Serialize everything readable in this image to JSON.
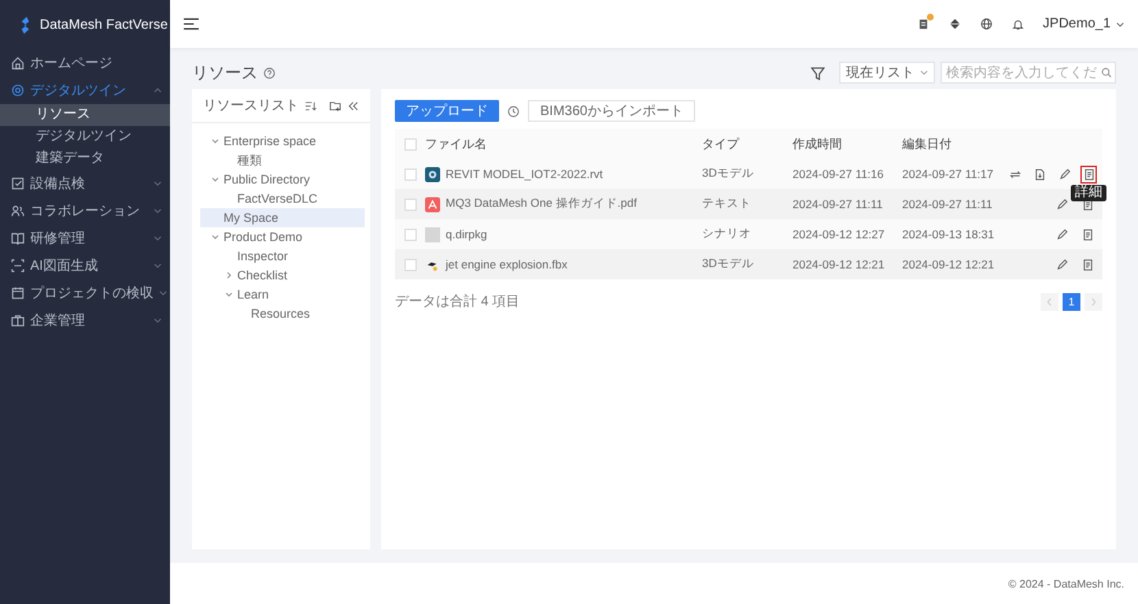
{
  "brand": {
    "name": "DataMesh FactVerse"
  },
  "sidebar": {
    "items": [
      {
        "label": "ホームページ",
        "selected": false
      },
      {
        "label": "デジタルツイン",
        "expanded": true,
        "selected": true,
        "children": [
          {
            "label": "リソース",
            "selected": true
          },
          {
            "label": "デジタルツイン",
            "selected": false
          },
          {
            "label": "建築データ",
            "selected": false
          }
        ]
      },
      {
        "label": "設備点検",
        "expanded": false,
        "selected": false
      },
      {
        "label": "コラボレーション",
        "expanded": false,
        "selected": false
      },
      {
        "label": "研修管理",
        "expanded": false,
        "selected": false
      },
      {
        "label": "AI図面生成",
        "expanded": false,
        "selected": false
      },
      {
        "label": "プロジェクトの検収",
        "expanded": false,
        "selected": false
      },
      {
        "label": "企業管理",
        "expanded": false,
        "selected": false
      }
    ]
  },
  "header": {
    "notification_badge": true,
    "user": "JPDemo_1"
  },
  "page": {
    "title": "リソース"
  },
  "filter": {
    "scope": "現在リスト",
    "placeholder": "検索内容を入力してくだ"
  },
  "tree_panel": {
    "title": "リソースリスト",
    "nodes": [
      {
        "label": "Enterprise space",
        "expanded": true,
        "selected": false,
        "children": [
          {
            "label": "種類",
            "selected": false
          }
        ]
      },
      {
        "label": "Public Directory",
        "expanded": true,
        "selected": false,
        "children": [
          {
            "label": "FactVerseDLC",
            "selected": false
          }
        ]
      },
      {
        "label": "My Space",
        "selected": true
      },
      {
        "label": "Product Demo",
        "expanded": true,
        "selected": false,
        "children": [
          {
            "label": "Inspector",
            "selected": false
          },
          {
            "label": "Checklist",
            "expanded": false,
            "selected": false
          },
          {
            "label": "Learn",
            "expanded": true,
            "selected": false,
            "children": [
              {
                "label": "Resources",
                "selected": false
              }
            ]
          }
        ]
      }
    ]
  },
  "toolbar": {
    "upload": "アップロード",
    "import": "BIM360からインポート"
  },
  "table": {
    "all_checked": false,
    "columns": [
      "ファイル名",
      "タイプ",
      "作成時間",
      "編集日付"
    ],
    "rows": [
      {
        "kind": "model",
        "checked": false,
        "name": "REVIT MODEL_IOT2-2022.rvt",
        "type": "3Dモデル",
        "created": "2024-09-27 11:16",
        "edited": "2024-09-27 11:17",
        "actions": [
          {
            "kind": "sync",
            "highlighted": false
          },
          {
            "kind": "download",
            "highlighted": false
          },
          {
            "kind": "edit",
            "highlighted": false
          },
          {
            "kind": "detail",
            "highlighted": true
          }
        ]
      },
      {
        "kind": "pdf",
        "checked": false,
        "name": "MQ3 DataMesh One 操作ガイド.pdf",
        "type": "テキスト",
        "created": "2024-09-27 11:11",
        "edited": "2024-09-27 11:11",
        "actions": [
          {
            "kind": "edit",
            "highlighted": false
          },
          {
            "kind": "detail",
            "highlighted": false
          }
        ]
      },
      {
        "kind": "image",
        "checked": false,
        "name": "q.dirpkg",
        "type": "シナリオ",
        "created": "2024-09-12 12:27",
        "edited": "2024-09-13 18:31",
        "actions": [
          {
            "kind": "edit",
            "highlighted": false
          },
          {
            "kind": "detail",
            "highlighted": false
          }
        ]
      },
      {
        "kind": "fbx",
        "checked": false,
        "name": "jet engine explosion.fbx",
        "type": "3Dモデル",
        "created": "2024-09-12 12:21",
        "edited": "2024-09-12 12:21",
        "actions": [
          {
            "kind": "edit",
            "highlighted": false
          },
          {
            "kind": "detail",
            "highlighted": false
          }
        ]
      }
    ]
  },
  "tooltip": "詳細",
  "summary": "データは合計 4 項目",
  "pagination": {
    "pages": [
      {
        "label": "1",
        "selected": true
      }
    ]
  },
  "footer": "© 2024 - DataMesh Inc."
}
